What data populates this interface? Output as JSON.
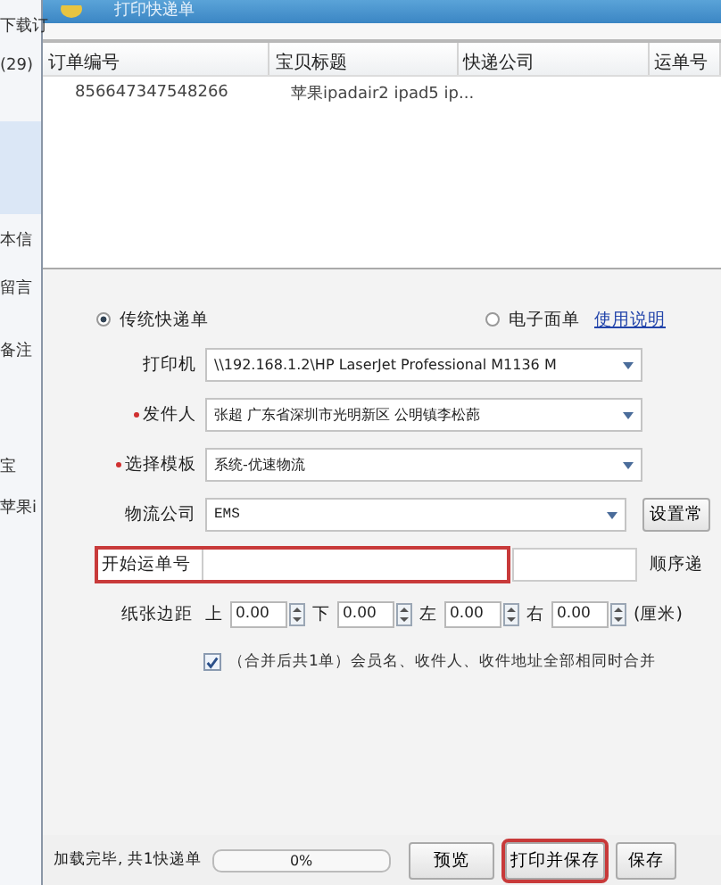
{
  "background_app": {
    "items": [
      "下载订",
      "(29)",
      "本信",
      "留言",
      "备注",
      "宝",
      "苹果i"
    ]
  },
  "window": {
    "title": "打印快递单"
  },
  "table": {
    "columns": [
      "订单编号",
      "宝贝标题",
      "快递公司",
      "运单号"
    ],
    "rows": [
      [
        "856647347548266",
        "苹果ipadair2 ipad5 ip..."
      ]
    ]
  },
  "mode": [
    {
      "label": "传统快递单",
      "selected": true
    },
    {
      "label": "电子面单",
      "selected": false
    }
  ],
  "help_link": "使用说明",
  "fields": [
    {
      "label": "打印机",
      "required": false,
      "value": "\\\\192.168.1.2\\HP LaserJet Professional M1136 M"
    },
    {
      "label": "发件人",
      "required": true,
      "value": "张超 广东省深圳市光明新区 公明镇李松蓢"
    },
    {
      "label": "选择模板",
      "required": true,
      "value": "系统-优速物流"
    }
  ],
  "logistics": {
    "label": "物流公司",
    "value": "EMS",
    "button": "设置常"
  },
  "start_number": {
    "label": "开始运单号",
    "highlighted": true,
    "note": "顺序递"
  },
  "margins": {
    "label": "纸张边距",
    "items": [
      {
        "label": "上",
        "value": "0.00"
      },
      {
        "label": "下",
        "value": "0.00"
      },
      {
        "label": "左",
        "value": "0.00"
      },
      {
        "label": "右",
        "value": "0.00"
      }
    ],
    "unit": "(厘米)"
  },
  "merge": {
    "checked": true,
    "text": "（合并后共1单）会员名、收件人、收件地址全部相同时合并"
  },
  "status": {
    "text": "加载完毕, 共1快递单",
    "level": 0,
    "percent": "0%"
  },
  "buttons": [
    {
      "label": "预览",
      "highlighted": false
    },
    {
      "label": "打印并保存",
      "highlighted": true
    },
    {
      "label": "保存",
      "highlighted": false
    }
  ]
}
